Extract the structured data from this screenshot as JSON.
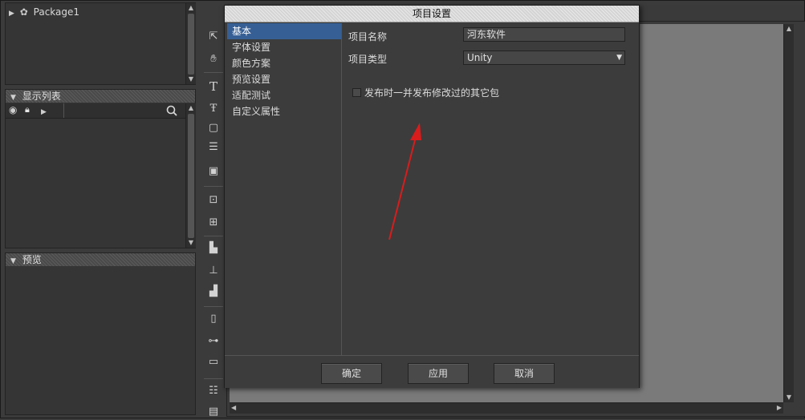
{
  "tree": {
    "package_label": "Package1"
  },
  "display_list": {
    "header": "显示列表"
  },
  "preview": {
    "header": "预览"
  },
  "dialog": {
    "title": "项目设置",
    "nav": [
      "基本",
      "字体设置",
      "颜色方案",
      "预览设置",
      "适配测试",
      "自定义属性"
    ],
    "selected_nav": "基本",
    "project_name_label": "项目名称",
    "project_name_value": "河东软件",
    "project_type_label": "项目类型",
    "project_type_value": "Unity",
    "publish_checkbox_label": "发布时一并发布修改过的其它包",
    "publish_checkbox_checked": false,
    "buttons": {
      "ok": "确定",
      "apply": "应用",
      "cancel": "取消"
    }
  },
  "colors": {
    "selected_nav": "#365f95",
    "annotation_arrow": "#d91c1c"
  },
  "icons": {
    "toolbar": [
      "pointer-icon",
      "hand-icon",
      "text-icon",
      "rich-text-icon",
      "shape-icon",
      "list-icon",
      "component-icon",
      "image-icon",
      "resize-icon",
      "align-left-icon",
      "align-center-icon",
      "align-bottom-icon",
      "distribute-h-icon",
      "distribute-center-icon",
      "distribute-bottom-icon",
      "layout-icon",
      "more-icon"
    ]
  }
}
